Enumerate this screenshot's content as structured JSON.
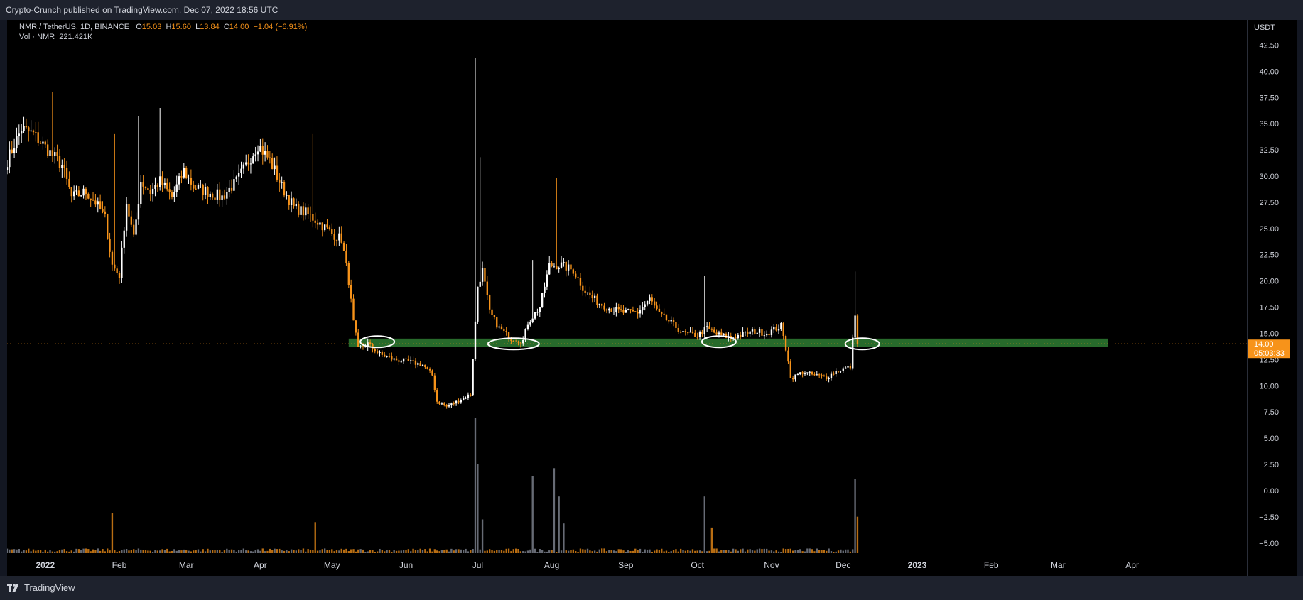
{
  "header": {
    "publisher_line": "Crypto-Crunch published on TradingView.com, Dec 07, 2022 18:56 UTC"
  },
  "legend": {
    "symbol": "NMR / TetherUS, 1D, BINANCE",
    "o_label": "O",
    "o_value": "15.03",
    "h_label": "H",
    "h_value": "15.60",
    "l_label": "L",
    "l_value": "13.84",
    "c_label": "C",
    "c_value": "14.00",
    "change": "−1.04 (−6.91%)",
    "vol_label": "Vol · NMR",
    "vol_value": "221.421K"
  },
  "footer": {
    "brand": "TradingView"
  },
  "colors": {
    "up": "#ffffff",
    "down": "#f7931a",
    "support": "#2e7d32",
    "price_tag": "#f7931a",
    "background": "#000000"
  },
  "chart_data": {
    "type": "candlestick",
    "currency_label": "USDT",
    "y_ticks": [
      "42.50",
      "40.00",
      "37.50",
      "35.00",
      "32.50",
      "30.00",
      "27.50",
      "25.00",
      "22.50",
      "20.00",
      "17.50",
      "15.00",
      "12.50",
      "10.00",
      "7.50",
      "5.00",
      "2.50",
      "0.00",
      "−2.50",
      "−5.00"
    ],
    "y_tick_values": [
      42.5,
      40,
      37.5,
      35,
      32.5,
      30,
      27.5,
      25,
      22.5,
      20,
      17.5,
      15,
      12.5,
      10,
      7.5,
      5,
      2.5,
      0,
      -2.5,
      -5
    ],
    "ylim": [
      -6.1,
      44.9
    ],
    "x_ticks": [
      {
        "label": "2022",
        "date": "2022-01-01"
      },
      {
        "label": "Feb",
        "date": "2022-02-01"
      },
      {
        "label": "Mar",
        "date": "2022-03-01"
      },
      {
        "label": "Apr",
        "date": "2022-04-01"
      },
      {
        "label": "May",
        "date": "2022-05-01"
      },
      {
        "label": "Jun",
        "date": "2022-06-01"
      },
      {
        "label": "Jul",
        "date": "2022-07-01"
      },
      {
        "label": "Aug",
        "date": "2022-08-01"
      },
      {
        "label": "Sep",
        "date": "2022-09-01"
      },
      {
        "label": "Oct",
        "date": "2022-10-01"
      },
      {
        "label": "Nov",
        "date": "2022-11-01"
      },
      {
        "label": "Dec",
        "date": "2022-12-01"
      },
      {
        "label": "2023",
        "date": "2023-01-01"
      },
      {
        "label": "Feb",
        "date": "2023-02-01"
      },
      {
        "label": "Mar",
        "date": "2023-03-01"
      },
      {
        "label": "Apr",
        "date": "2023-04-01"
      }
    ],
    "xlim": [
      "2021-12-16",
      "2023-05-19"
    ],
    "close_path": [
      [
        "2021-12-16",
        31.5
      ],
      [
        "2021-12-22",
        34.5
      ],
      [
        "2021-12-27",
        34.0
      ],
      [
        "2022-01-02",
        32.5
      ],
      [
        "2022-01-08",
        31.0
      ],
      [
        "2022-01-12",
        28.0
      ],
      [
        "2022-01-18",
        28.5
      ],
      [
        "2022-01-22",
        27.5
      ],
      [
        "2022-01-26",
        26.0
      ],
      [
        "2022-01-29",
        21.5
      ],
      [
        "2022-02-01",
        20.5
      ],
      [
        "2022-02-04",
        27.5
      ],
      [
        "2022-02-07",
        24.0
      ],
      [
        "2022-02-10",
        29.5
      ],
      [
        "2022-02-14",
        28.5
      ],
      [
        "2022-02-18",
        29.5
      ],
      [
        "2022-02-23",
        28.0
      ],
      [
        "2022-02-28",
        30.5
      ],
      [
        "2022-03-04",
        29.0
      ],
      [
        "2022-03-10",
        28.5
      ],
      [
        "2022-03-16",
        28.0
      ],
      [
        "2022-03-22",
        29.5
      ],
      [
        "2022-03-26",
        31.0
      ],
      [
        "2022-03-31",
        33.0
      ],
      [
        "2022-04-05",
        31.5
      ],
      [
        "2022-04-10",
        29.0
      ],
      [
        "2022-04-15",
        27.0
      ],
      [
        "2022-04-20",
        26.5
      ],
      [
        "2022-04-26",
        25.5
      ],
      [
        "2022-05-01",
        24.5
      ],
      [
        "2022-05-05",
        24.0
      ],
      [
        "2022-05-08",
        20.0
      ],
      [
        "2022-05-10",
        16.0
      ],
      [
        "2022-05-12",
        13.5
      ],
      [
        "2022-05-16",
        14.0
      ],
      [
        "2022-05-21",
        13.0
      ],
      [
        "2022-05-27",
        12.5
      ],
      [
        "2022-06-02",
        12.3
      ],
      [
        "2022-06-08",
        12.0
      ],
      [
        "2022-06-12",
        11.0
      ],
      [
        "2022-06-14",
        8.5
      ],
      [
        "2022-06-18",
        8.0
      ],
      [
        "2022-06-24",
        8.7
      ],
      [
        "2022-06-28",
        9.2
      ],
      [
        "2022-07-01",
        19.5
      ],
      [
        "2022-07-03",
        21.0
      ],
      [
        "2022-07-06",
        17.0
      ],
      [
        "2022-07-10",
        15.5
      ],
      [
        "2022-07-15",
        14.5
      ],
      [
        "2022-07-20",
        14.3
      ],
      [
        "2022-07-22",
        16.0
      ],
      [
        "2022-07-27",
        17.5
      ],
      [
        "2022-07-31",
        21.5
      ],
      [
        "2022-08-05",
        21.5
      ],
      [
        "2022-08-10",
        21.0
      ],
      [
        "2022-08-15",
        19.0
      ],
      [
        "2022-08-20",
        18.0
      ],
      [
        "2022-08-26",
        17.3
      ],
      [
        "2022-08-31",
        17.0
      ],
      [
        "2022-09-06",
        17.0
      ],
      [
        "2022-09-11",
        18.3
      ],
      [
        "2022-09-15",
        16.8
      ],
      [
        "2022-09-20",
        16.0
      ],
      [
        "2022-09-25",
        15.0
      ],
      [
        "2022-10-01",
        14.8
      ],
      [
        "2022-10-05",
        15.5
      ],
      [
        "2022-10-09",
        14.9
      ],
      [
        "2022-10-15",
        14.6
      ],
      [
        "2022-10-20",
        14.9
      ],
      [
        "2022-10-25",
        15.2
      ],
      [
        "2022-10-30",
        15.0
      ],
      [
        "2022-11-05",
        15.7
      ],
      [
        "2022-11-08",
        12.5
      ],
      [
        "2022-11-09",
        10.7
      ],
      [
        "2022-11-14",
        11.3
      ],
      [
        "2022-11-19",
        11.0
      ],
      [
        "2022-11-24",
        10.8
      ],
      [
        "2022-11-29",
        11.5
      ],
      [
        "2022-12-04",
        11.8
      ],
      [
        "2022-12-06",
        17.0
      ],
      [
        "2022-12-07",
        14.0
      ]
    ],
    "spike_highs": [
      [
        "2022-01-04",
        38.0
      ],
      [
        "2022-01-30",
        34.0
      ],
      [
        "2022-02-09",
        35.7
      ],
      [
        "2022-02-18",
        36.5
      ],
      [
        "2022-04-23",
        34.0
      ],
      [
        "2022-06-30",
        41.3
      ],
      [
        "2022-07-02",
        31.8
      ],
      [
        "2022-07-24",
        22.0
      ],
      [
        "2022-08-03",
        29.8
      ],
      [
        "2022-10-04",
        20.5
      ],
      [
        "2022-12-06",
        20.9
      ]
    ],
    "volume_spikes": [
      [
        "2022-01-29",
        0.3
      ],
      [
        "2022-04-24",
        0.23
      ],
      [
        "2022-06-30",
        1.0
      ],
      [
        "2022-07-01",
        0.66
      ],
      [
        "2022-07-24",
        0.57
      ],
      [
        "2022-08-02",
        0.63
      ],
      [
        "2022-08-04",
        0.42
      ],
      [
        "2022-10-04",
        0.42
      ],
      [
        "2022-10-07",
        0.19
      ],
      [
        "2022-12-06",
        0.55
      ],
      [
        "2022-12-07",
        0.27
      ],
      [
        "2022-07-03",
        0.25
      ],
      [
        "2022-08-06",
        0.22
      ]
    ],
    "support_zone": {
      "from": 14.5,
      "to": 13.7,
      "start": "2022-05-08",
      "end": "2023-03-22"
    },
    "circles": [
      {
        "date": "2022-05-20",
        "value": 14.2
      },
      {
        "date": "2022-07-16",
        "value": 14.0
      },
      {
        "date": "2022-10-10",
        "value": 14.2
      },
      {
        "date": "2022-12-09",
        "value": 14.0
      }
    ],
    "last_price": 14.0,
    "last_price_label": "14.00",
    "countdown_label": "05:03:33"
  }
}
